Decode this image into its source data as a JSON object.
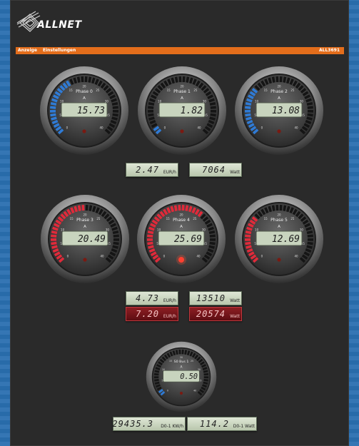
{
  "header": {
    "logo_text": "ALLNET",
    "menu": [
      "Anzeige",
      "Einstellungen"
    ],
    "device": "ALL3691"
  },
  "gauges": [
    {
      "label": "Phase 0",
      "unit": "A",
      "value": "15.73",
      "fill": 0.4,
      "color": "#2f7bd6",
      "led": false
    },
    {
      "label": "Phase 1",
      "unit": "A",
      "value": "1.82",
      "fill": 0.06,
      "color": "#2f7bd6",
      "led": false
    },
    {
      "label": "Phase 2",
      "unit": "A",
      "value": "13.08",
      "fill": 0.33,
      "color": "#2f7bd6",
      "led": false
    },
    {
      "label": "Phase 3",
      "unit": "A",
      "value": "20.49",
      "fill": 0.51,
      "color": "#e02a3a",
      "led": false
    },
    {
      "label": "Phase 4",
      "unit": "A",
      "value": "25.69",
      "fill": 0.64,
      "color": "#e02a3a",
      "led": true
    },
    {
      "label": "Phase 5",
      "unit": "A",
      "value": "12.69",
      "fill": 0.32,
      "color": "#e02a3a",
      "led": false
    },
    {
      "label": "S0 Bus 1",
      "unit": "A",
      "value": "0.50",
      "fill": 0.04,
      "color": "#2f7bd6",
      "led": false
    }
  ],
  "readouts": [
    {
      "value": "2.47",
      "unit": "EUR/h",
      "style": "green"
    },
    {
      "value": "7064",
      "unit": "Watt",
      "style": "green"
    },
    {
      "value": "4.73",
      "unit": "EUR/h",
      "style": "green"
    },
    {
      "value": "13510",
      "unit": "Watt",
      "style": "green"
    },
    {
      "value": "7.20",
      "unit": "EUR/h",
      "style": "red"
    },
    {
      "value": "20574",
      "unit": "Watt",
      "style": "red"
    },
    {
      "value": "29435.3",
      "unit": "D0-1 KW/h",
      "style": "green"
    },
    {
      "value": "114.2",
      "unit": "D0-1 Watt",
      "style": "green"
    }
  ],
  "colors": {
    "accent": "#e36d1b",
    "background": "#2a6fb0",
    "panel": "#2a2a2a"
  }
}
